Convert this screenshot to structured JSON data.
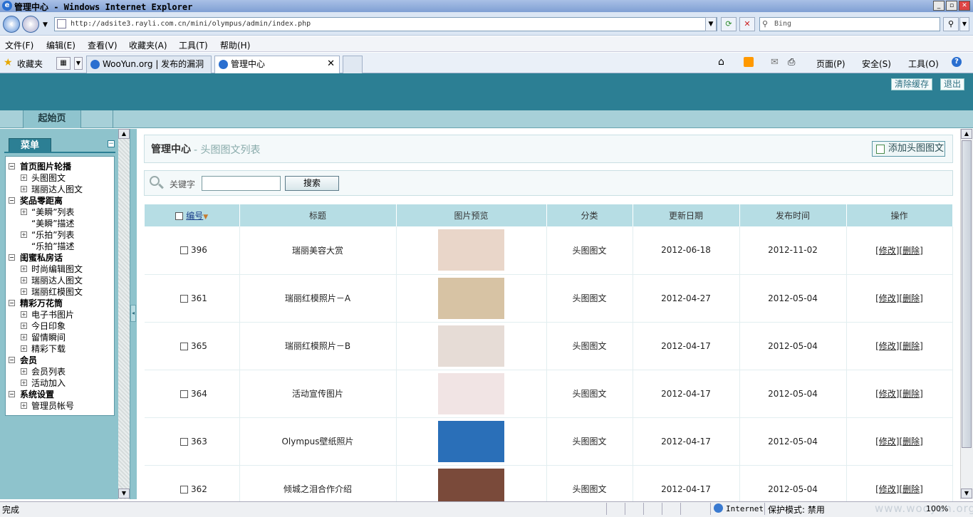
{
  "window": {
    "title": "管理中心 - Windows Internet Explorer",
    "controls": [
      "_",
      "▫",
      "✕"
    ]
  },
  "browser": {
    "address": "http://adsite3.rayli.com.cn/mini/olympus/admin/index.php",
    "search_placeholder": "Bing",
    "menu": [
      "文件(F)",
      "编辑(E)",
      "查看(V)",
      "收藏夹(A)",
      "工具(T)",
      "帮助(H)"
    ],
    "favorites_label": "收藏夹",
    "tabs": [
      {
        "label": "WooYun.org | 发布的漏洞"
      },
      {
        "label": "管理中心"
      }
    ],
    "toolbar": {
      "page": "页面(P)",
      "safety": "安全(S)",
      "tools": "工具(O)"
    }
  },
  "app": {
    "header_buttons": {
      "clear_cache": "清除缓存",
      "logout": "退出"
    },
    "nav_tab": "起始页",
    "sidebar": {
      "menu_title": "菜单",
      "tree": [
        {
          "label": "首页图片轮播",
          "children": [
            "头图图文",
            "瑞丽达人图文"
          ]
        },
        {
          "label": "奖品零距离",
          "children": [
            "“美瞬”列表",
            "“美瞬”描述",
            "“乐拍”列表",
            "“乐拍”描述"
          ]
        },
        {
          "label": "闺蜜私房话",
          "children": [
            "时尚编辑图文",
            "瑞丽达人图文",
            "瑞丽红模图文"
          ]
        },
        {
          "label": "精彩万花筒",
          "children": [
            "电子书图片",
            "今日印象",
            "留情瞬间",
            "精彩下载"
          ]
        },
        {
          "label": "会员",
          "children": [
            "会员列表",
            "活动加入"
          ]
        },
        {
          "label": "系统设置",
          "children": [
            "管理员帐号"
          ]
        }
      ]
    },
    "main": {
      "title": "管理中心",
      "subtitle": "- 头图图文列表",
      "add_button": "添加头图图文",
      "search": {
        "keyword_label": "关键字",
        "keyword_value": "",
        "button": "搜索"
      },
      "table": {
        "headers": [
          "编号",
          "标题",
          "图片预览",
          "分类",
          "更新日期",
          "发布时间",
          "操作"
        ],
        "rows": [
          {
            "id": "396",
            "title": "瑞丽美容大赏",
            "category": "头图图文",
            "updated": "2012-06-18",
            "published": "2012-11-02",
            "thumb_color": "#e9d6c9"
          },
          {
            "id": "361",
            "title": "瑞丽红模照片－A",
            "category": "头图图文",
            "updated": "2012-04-27",
            "published": "2012-05-04",
            "thumb_color": "#d7c3a4"
          },
          {
            "id": "365",
            "title": "瑞丽红模照片－B",
            "category": "头图图文",
            "updated": "2012-04-17",
            "published": "2012-05-04",
            "thumb_color": "#e6dcd6"
          },
          {
            "id": "364",
            "title": "活动宣传图片",
            "category": "头图图文",
            "updated": "2012-04-17",
            "published": "2012-05-04",
            "thumb_color": "#f1e4e4"
          },
          {
            "id": "363",
            "title": "Olympus壁纸照片",
            "category": "头图图文",
            "updated": "2012-04-17",
            "published": "2012-05-04",
            "thumb_color": "#2a6fb8"
          },
          {
            "id": "362",
            "title": "倾城之泪合作介绍",
            "category": "头图图文",
            "updated": "2012-04-17",
            "published": "2012-05-04",
            "thumb_color": "#7a4a3a"
          }
        ],
        "op_edit": "[修改]",
        "op_delete": "[删除]"
      }
    }
  },
  "statusbar": {
    "text": "完成",
    "zone": "Internet",
    "protected_mode": "保护模式: 禁用",
    "zoom": "100%",
    "watermark": "www.wooyun.org"
  }
}
